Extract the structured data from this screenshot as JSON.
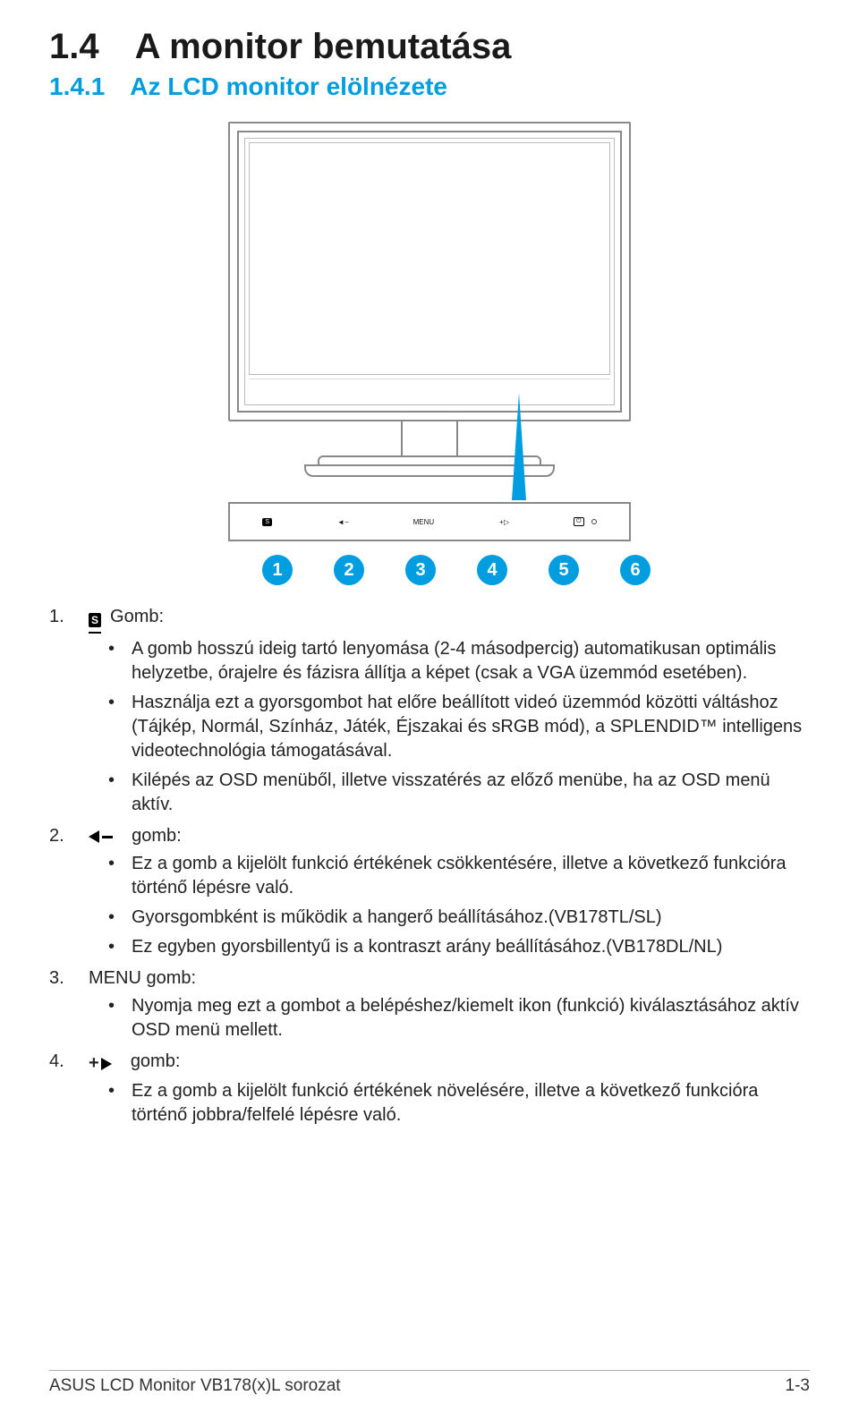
{
  "section": {
    "num_h1": "1.4",
    "title_h1": "A monitor bemutatása",
    "num_h2": "1.4.1",
    "title_h2": "Az LCD monitor elölnézete"
  },
  "button_strip": {
    "btn1": "S",
    "btn2": "◄ −",
    "btn3": "MENU",
    "btn4": "+ ▷",
    "btn5": "⏻"
  },
  "callouts": [
    "1",
    "2",
    "3",
    "4",
    "5",
    "6"
  ],
  "items": {
    "i1": {
      "num": "1.",
      "label": "Gomb:",
      "b1": "A gomb hosszú ideig tartó lenyomása (2-4 másodpercig) automatikusan optimális helyzetbe, órajelre és fázisra állítja a képet (csak a VGA üzemmód esetében).",
      "b2": "Használja ezt a gyorsgombot hat előre beállított videó üzemmód közötti váltáshoz (Tájkép, Normál, Színház, Játék, Éjszakai és sRGB mód), a SPLENDID™ intelligens videotechnológia támogatásával.",
      "b3": "Kilépés az OSD menüből, illetve visszatérés az előző menübe, ha az OSD menü aktív."
    },
    "i2": {
      "num": "2.",
      "label": "gomb:",
      "b1": "Ez a gomb a kijelölt funkció értékének csökkentésére, illetve a következő funkcióra történő lépésre való.",
      "b2": "Gyorsgombként is működik a hangerő beállításához.(VB178TL/SL)",
      "b3": "Ez egyben gyorsbillentyű is a kontraszt arány beállításához.(VB178DL/NL)"
    },
    "i3": {
      "num": "3.",
      "label": "MENU gomb:",
      "b1": "Nyomja meg ezt a gombot a belépéshez/kiemelt ikon (funkció) kiválasztásához aktív OSD menü mellett."
    },
    "i4": {
      "num": "4.",
      "label": "gomb:",
      "b1": "Ez a gomb a kijelölt funkció értékének növelésére, illetve a következő funkcióra történő jobbra/felfelé lépésre való."
    }
  },
  "footer": {
    "left": "ASUS LCD Monitor VB178(x)L sorozat",
    "right": "1-3"
  }
}
